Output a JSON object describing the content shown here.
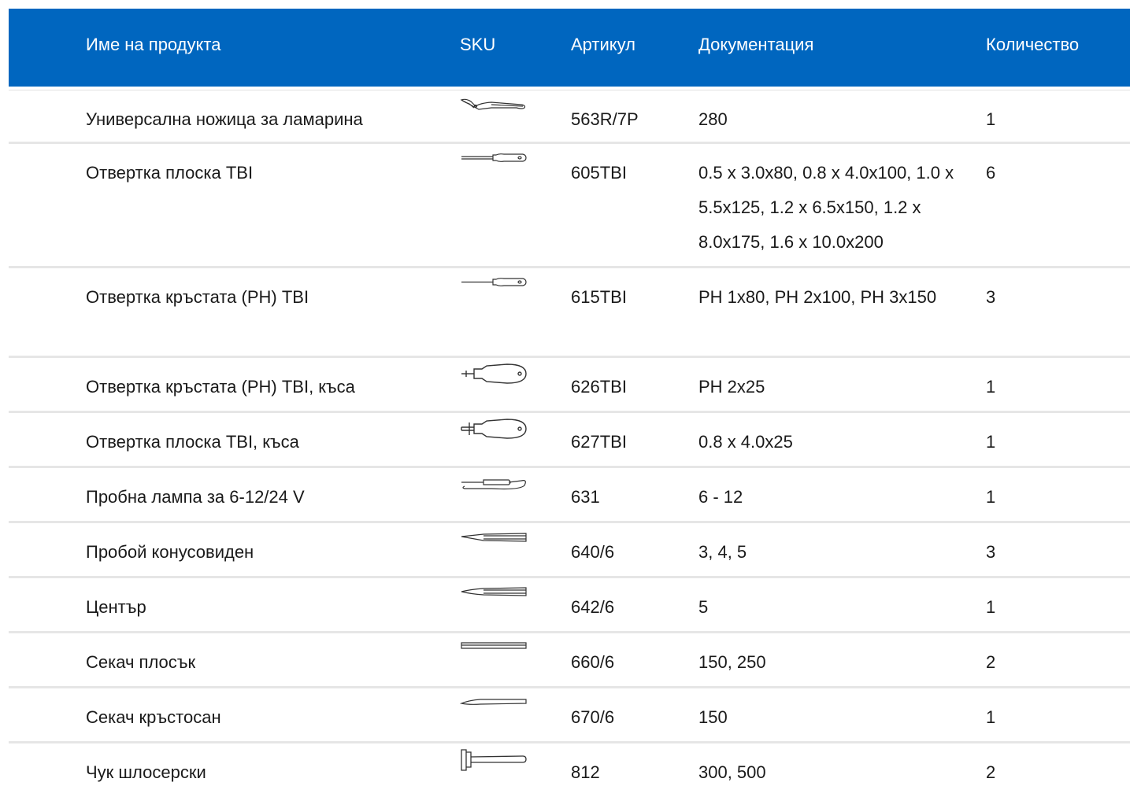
{
  "table": {
    "headers": {
      "name": "Име на продукта",
      "sku": "SKU",
      "article": "Артикул",
      "documentation": "Документация",
      "quantity": "Количество"
    },
    "rows": [
      {
        "name": "Универсална ножица за ламарина",
        "icon": "tin-snips-icon",
        "article": "563R/7P",
        "documentation": "280",
        "quantity": "1"
      },
      {
        "name": "Отвертка плоска TBI",
        "icon": "flat-screwdriver-icon",
        "article": "605TBI",
        "documentation": "0.5 x 3.0x80, 0.8 x 4.0x100, 1.0 x 5.5x125, 1.2 x 6.5x150, 1.2 x 8.0x175, 1.6 x 10.0x200",
        "quantity": "6"
      },
      {
        "name": "Отвертка кръстата (PH) TBI",
        "icon": "phillips-screwdriver-icon",
        "article": "615TBI",
        "documentation": "PH 1x80, PH 2x100, PH 3x150",
        "quantity": "3"
      },
      {
        "name": "Отвертка кръстата (PH) TBI, къса",
        "icon": "stubby-phillips-screwdriver-icon",
        "article": "626TBI",
        "documentation": "PH 2x25",
        "quantity": "1"
      },
      {
        "name": "Отвертка плоска TBI, къса",
        "icon": "stubby-flat-screwdriver-icon",
        "article": "627TBI",
        "documentation": "0.8 x 4.0x25",
        "quantity": "1"
      },
      {
        "name": "Пробна лампа за 6-12/24 V",
        "icon": "test-lamp-icon",
        "article": "631",
        "documentation": "6 - 12",
        "quantity": "1"
      },
      {
        "name": "Пробой конусовиден",
        "icon": "taper-punch-icon",
        "article": "640/6",
        "documentation": "3, 4, 5",
        "quantity": "3"
      },
      {
        "name": "Център",
        "icon": "center-punch-icon",
        "article": "642/6",
        "documentation": "5",
        "quantity": "1"
      },
      {
        "name": "Секач плосък",
        "icon": "flat-chisel-icon",
        "article": "660/6",
        "documentation": "150, 250",
        "quantity": "2"
      },
      {
        "name": "Секач кръстосан",
        "icon": "cross-chisel-icon",
        "article": "670/6",
        "documentation": "150",
        "quantity": "1"
      },
      {
        "name": "Чук шлосерски",
        "icon": "hammer-icon",
        "article": "812",
        "documentation": "300, 500",
        "quantity": "2"
      }
    ]
  },
  "colors": {
    "header_bg": "#0066bf",
    "header_text": "#ffffff",
    "row_divider": "#e6e6e6",
    "body_text": "#1a1a1a"
  }
}
